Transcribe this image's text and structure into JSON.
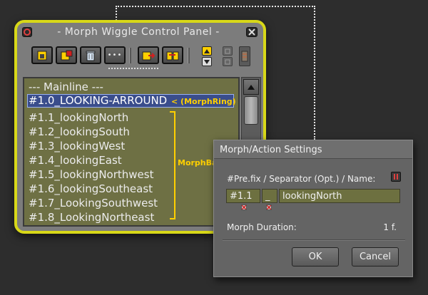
{
  "main_panel": {
    "title": "- Morph Wiggle Control Panel -",
    "toolbar": {
      "buttons": [
        "new-morph-icon",
        "add-morph-icon",
        "trash-icon",
        "more-icon",
        "export-icon",
        "import-icon"
      ],
      "more_label": "•••"
    },
    "list": {
      "header": "--- Mainline ---",
      "selected": "#1.0_LOOKING-ARROUND",
      "selected_note": "< (MorphRing)",
      "items": [
        "#1.1_lookingNorth",
        "#1.2_lookingSouth",
        "#1.3_lookingWest",
        "#1.4_lookingEast",
        "#1.5_lookingNorthwest",
        "#1.6_lookingSoutheast",
        "#1.7_LookingSouthwest",
        "#1.8_LookingNortheast"
      ],
      "group_label": "MorphBalls"
    }
  },
  "settings_dialog": {
    "title": "Morph/Action Settings",
    "name_label": "#Pre.fix / Separator (Opt.) / Name:",
    "prefix_value": "#1.1",
    "separator_value": "_",
    "name_value": "lookingNorth",
    "duration_label": "Morph Duration:",
    "duration_value": "1 f.",
    "ok_label": "OK",
    "cancel_label": "Cancel"
  },
  "colors": {
    "panel_border": "#d8d818",
    "list_background": "#6e7044",
    "selection": "#3a4d8c",
    "annotation": "#ffd000"
  }
}
